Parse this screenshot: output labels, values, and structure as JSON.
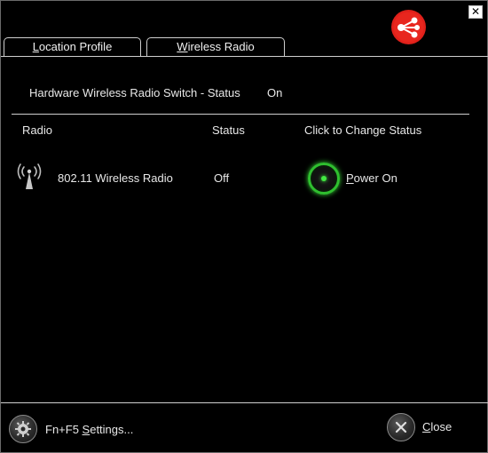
{
  "window": {
    "close_glyph": "✕"
  },
  "tabs": [
    {
      "prefix": "",
      "accel": "L",
      "rest": "ocation Profile",
      "selected": false
    },
    {
      "prefix": "",
      "accel": "W",
      "rest": "ireless Radio",
      "selected": true
    }
  ],
  "hardware_switch": {
    "label": "Hardware Wireless Radio Switch - Status",
    "value": "On"
  },
  "table": {
    "headers": [
      "Radio",
      "Status",
      "Click to Change Status"
    ],
    "rows": [
      {
        "icon": "antenna-icon",
        "name": "802.11 Wireless Radio",
        "status": "Off",
        "action_accel": "P",
        "action_rest": "ower On"
      }
    ]
  },
  "footer": {
    "settings_prefix": "Fn+F5 ",
    "settings_accel": "S",
    "settings_rest": "ettings...",
    "close_accel": "C",
    "close_rest": "lose"
  },
  "colors": {
    "background": "#000000",
    "text": "#e8e8e8",
    "power_glow": "#2fbf2f",
    "logo_red": "#e0201a"
  },
  "icons": {
    "logo": "share-network-icon",
    "settings": "gear-icon",
    "close": "close-icon",
    "radio": "antenna-icon"
  }
}
